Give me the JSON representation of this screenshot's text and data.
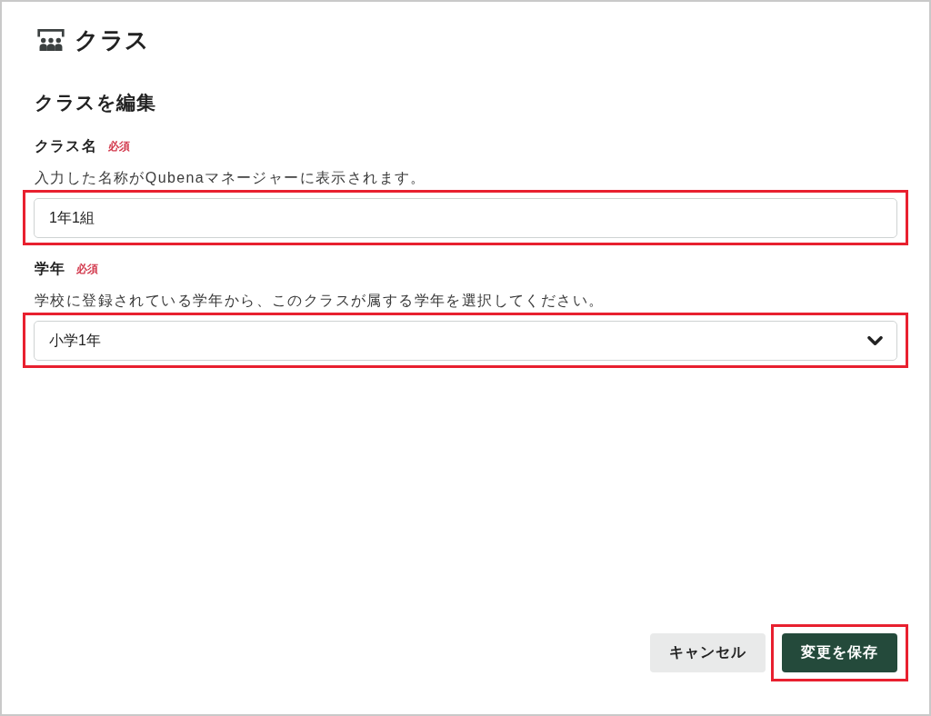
{
  "page": {
    "title": "クラス"
  },
  "form": {
    "heading": "クラスを編集",
    "fields": [
      {
        "kind": "text",
        "label": "クラス名",
        "required_badge": "必須",
        "description": "入力した名称がQubenaマネージャーに表示されます。",
        "value": "1年1組",
        "highlighted": true
      },
      {
        "kind": "select",
        "label": "学年",
        "required_badge": "必須",
        "description": "学校に登録されている学年から、このクラスが属する学年を選択してください。",
        "value": "小学1年",
        "highlighted": true
      }
    ]
  },
  "actions": [
    {
      "kind": "secondary",
      "label": "キャンセル",
      "highlighted": false
    },
    {
      "kind": "primary",
      "label": "変更を保存",
      "highlighted": true
    }
  ]
}
